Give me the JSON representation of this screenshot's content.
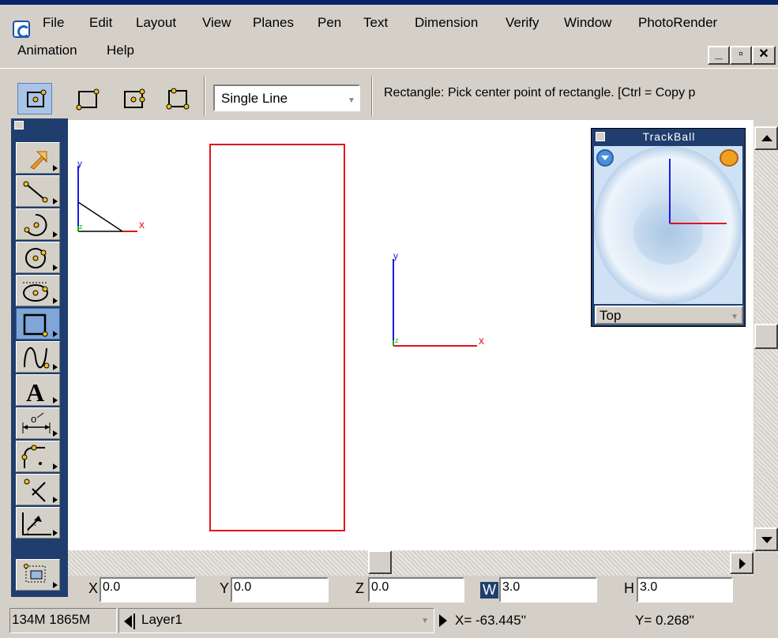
{
  "menu": {
    "row1": [
      "File",
      "Edit",
      "Layout",
      "View",
      "Planes",
      "Pen",
      "Text",
      "Dimension",
      "Verify",
      "Window",
      "PhotoRender"
    ],
    "row2": [
      "Animation",
      "Help"
    ]
  },
  "window_controls": {
    "minimize": "_",
    "restore": "▫",
    "close": "✕"
  },
  "toolbar": {
    "rectangle_modes": [
      "rectangle-center-icon",
      "rectangle-corner-icon",
      "rectangle-center-3pt-icon",
      "rectangle-3pt-icon"
    ],
    "line_style": "Single Line",
    "prompt": "Rectangle: Pick center point of rectangle. [Ctrl = Copy p"
  },
  "palette": {
    "tools": [
      "select-arrow-icon",
      "line-tool-icon",
      "arc-tool-icon",
      "circle-tool-icon",
      "ellipse-tool-icon",
      "rectangle-tool-icon",
      "curve-tool-icon",
      "text-tool-icon",
      "dimension-tool-icon",
      "fillet-tool-icon",
      "trim-tool-icon",
      "transform-tool-icon",
      "edit-points-tool-icon"
    ],
    "active_tool": "rectangle-tool-icon"
  },
  "canvas": {
    "axis_labels": {
      "x": "x",
      "y": "y",
      "z": "z"
    },
    "rectangle_color": "#e0141e"
  },
  "trackball": {
    "title": "TrackBall",
    "view": "Top"
  },
  "coords": {
    "x_label": "X",
    "x_value": "0.0",
    "y_label": "Y",
    "y_value": "0.0",
    "z_label": "Z",
    "z_value": "0.0",
    "w_label": "W",
    "w_value": "3.0",
    "h_label": "H",
    "h_value": "3.0"
  },
  "status": {
    "memory": "134M 1865M",
    "layer": "Layer1",
    "x_readout": "X=  -63.445''",
    "y_readout": "Y=    0.268''"
  },
  "colors": {
    "accent": "#1f3e6e",
    "x_axis": "#e0141e",
    "y_axis": "#1a1ae6",
    "z_axis": "#13b013"
  }
}
